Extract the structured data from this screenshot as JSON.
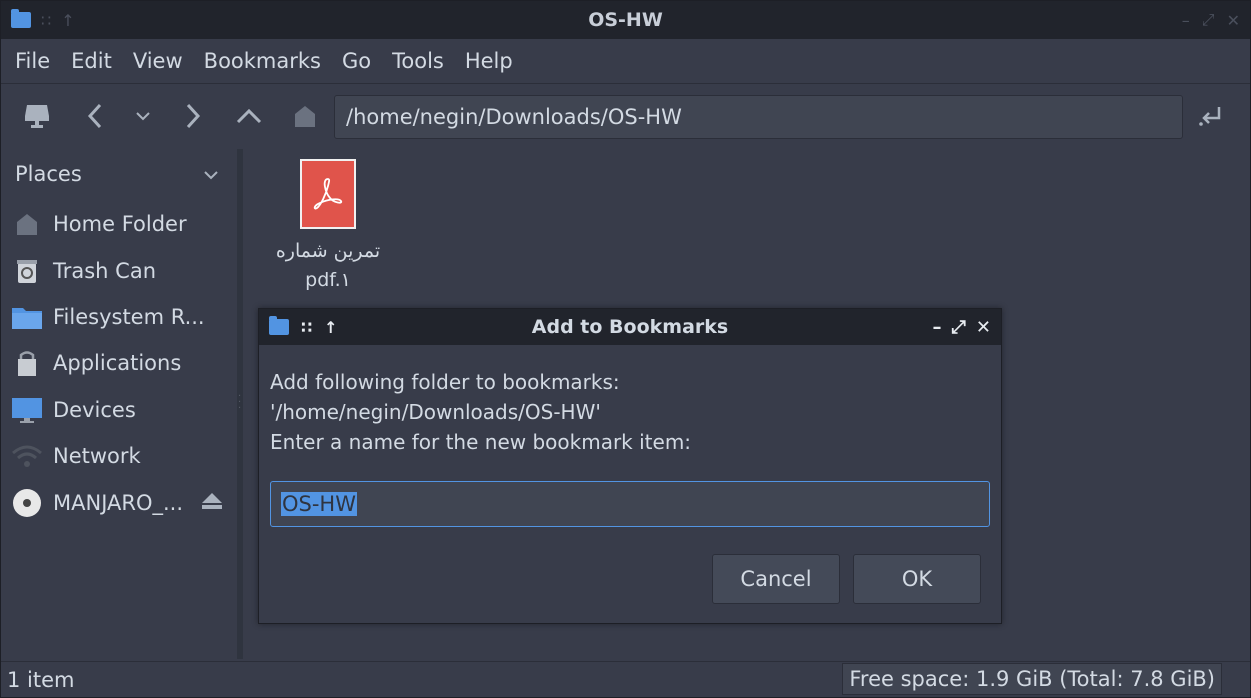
{
  "window": {
    "title": "OS-HW"
  },
  "menu": [
    "File",
    "Edit",
    "View",
    "Bookmarks",
    "Go",
    "Tools",
    "Help"
  ],
  "toolbar": {
    "path": "/home/negin/Downloads/OS-HW"
  },
  "sidebar": {
    "header": "Places",
    "items": [
      {
        "label": "Home Folder",
        "icon": "home-icon"
      },
      {
        "label": "Trash Can",
        "icon": "trash-icon"
      },
      {
        "label": "Filesystem R...",
        "icon": "folder-icon"
      },
      {
        "label": "Applications",
        "icon": "applications-icon"
      },
      {
        "label": "Devices",
        "icon": "monitor-icon"
      },
      {
        "label": "Network",
        "icon": "wifi-icon"
      },
      {
        "label": "MANJARO_...",
        "icon": "disc-icon"
      }
    ]
  },
  "content": {
    "file": {
      "name_line1": "تمرین شماره",
      "name_line2": "pdf.۱",
      "icon": "pdf-icon"
    }
  },
  "status": {
    "left": "1 item",
    "right": "Free space: 1.9 GiB (Total: 7.8 GiB)"
  },
  "dialog": {
    "title": "Add to Bookmarks",
    "line1": "Add following folder to bookmarks:",
    "line2": "'/home/negin/Downloads/OS-HW'",
    "line3": "Enter a name for the new bookmark item:",
    "input_value": "OS-HW",
    "cancel_label": "Cancel",
    "ok_label": "OK"
  },
  "colors": {
    "accent": "#5294e2",
    "pdf": "#e0544b",
    "background": "#383c4a",
    "titlebar": "#21242c"
  }
}
